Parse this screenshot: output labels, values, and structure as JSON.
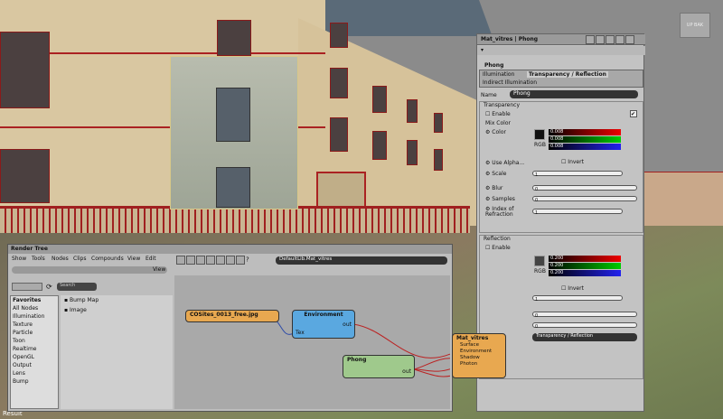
{
  "viewport": {
    "status_label": "Result",
    "cube_label": "UP   BAK"
  },
  "material_manager": {
    "title": "Mat_vitres | Phong",
    "type_label": "Phong",
    "tabs": [
      "Illumination",
      "Transparency / Reflection",
      "Indirect Illumination"
    ],
    "name_label": "Name",
    "name_value": "Phong",
    "transparency_section": "Transparency",
    "enable_label": "Enable",
    "mix_color_label": "Mix Color",
    "color_label": "Color",
    "rgb_label": "RGB",
    "color_values": [
      "0.008",
      "0.008",
      "0.008"
    ],
    "use_alpha_label": "Use Alpha...",
    "invert_label": "Invert",
    "scale_label": "Scale",
    "scale_value": "1",
    "blur_label": "Blur",
    "blur_value": "0",
    "samples_label": "Samples",
    "samples_value": "0",
    "ior_label": "Index of Refraction",
    "ior_value": "1",
    "reflection_section": "Reflection",
    "refl_color_values": [
      "0.200",
      "0.200",
      "0.200"
    ],
    "refl_invert_label": "Invert",
    "refl_scale_value": "1",
    "refl_values": [
      "0",
      "0"
    ],
    "mode_value": "Transparency / Reflection"
  },
  "render_tree": {
    "title": "Render Tree",
    "menu": [
      "Show",
      "Tools",
      "Nodes",
      "Clips",
      "Compounds",
      "View",
      "Edit"
    ],
    "view_label": "View",
    "path_value": "DefaultLib.Mat_vitres",
    "search_placeholder": "Search",
    "categories": [
      "Favorites",
      "All Nodes",
      "Illumination",
      "Texture",
      "Particle",
      "Toon",
      "Realtime",
      "OpenGL",
      "Output",
      "Lens",
      "Bump"
    ],
    "preset_items": [
      "Bump Map",
      "Image"
    ],
    "nodes": {
      "image": {
        "title": "COSites_0013_free.jpg"
      },
      "environment": {
        "title": "Environment",
        "ports_in": [
          "Tex"
        ],
        "ports_out": [
          "out"
        ]
      },
      "phong": {
        "title": "Phong",
        "ports_out": [
          "out"
        ]
      },
      "material": {
        "title": "Mat_vitres",
        "ports": [
          "Surface",
          "Environment",
          "Shadow",
          "Photon"
        ]
      }
    }
  }
}
